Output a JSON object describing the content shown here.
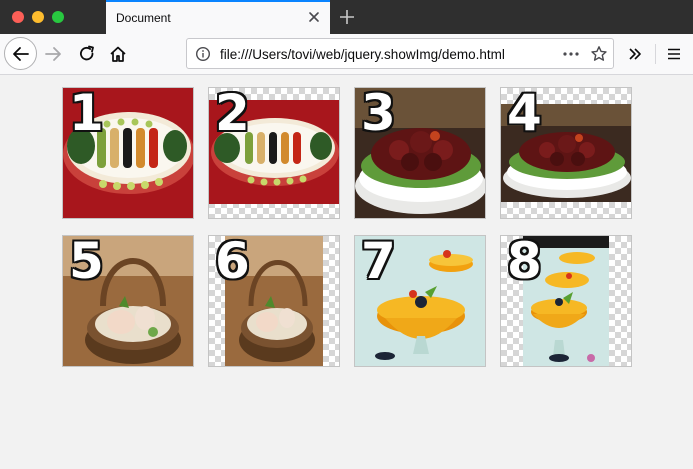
{
  "window": {
    "tab_title": "Document",
    "url": "file:///Users/tovi/web/jquery.showImg/demo.html"
  },
  "toolbar": {
    "back": "back-arrow-icon",
    "forward": "forward-arrow-icon",
    "reload": "reload-icon",
    "home": "home-icon",
    "page_actions": "ellipsis-icon",
    "bookmark": "star-icon",
    "overflow": "double-chevron-icon",
    "menu": "hamburger-icon"
  },
  "gallery": {
    "items": [
      {
        "label": "1",
        "subject": "caviar platter"
      },
      {
        "label": "2",
        "subject": "caviar platter"
      },
      {
        "label": "3",
        "subject": "braised pork"
      },
      {
        "label": "4",
        "subject": "braised pork"
      },
      {
        "label": "5",
        "subject": "basket dish"
      },
      {
        "label": "6",
        "subject": "basket dish"
      },
      {
        "label": "7",
        "subject": "mango dessert cups"
      },
      {
        "label": "8",
        "subject": "mango dessert cups"
      }
    ]
  },
  "colors": {
    "tab_accent": "#0a84ff",
    "titlebar": "#2f2f2f",
    "page_bg": "#f2f2f2"
  }
}
